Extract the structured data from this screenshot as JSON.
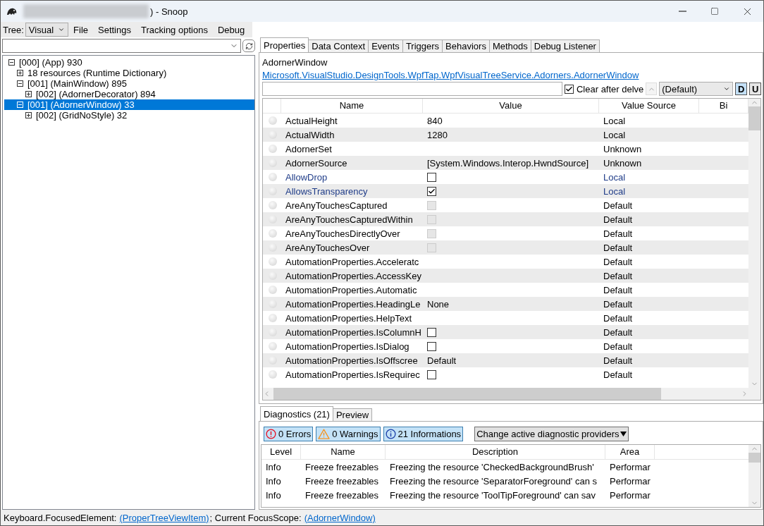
{
  "window": {
    "title": ") - Snoop"
  },
  "toolbar": {
    "tree_label": "Tree:",
    "tree_mode": "Visual",
    "menu": [
      "File",
      "Settings",
      "Tracking options",
      "Debug"
    ]
  },
  "tree": [
    {
      "label": "[000]  (App) 930",
      "expanded": true,
      "selected": false,
      "children": [
        {
          "label": "18 resources (Runtime Dictionary)",
          "expanded": false,
          "selected": false
        },
        {
          "label": "[001]  (MainWindow) 895",
          "expanded": true,
          "selected": false,
          "children": [
            {
              "label": "[002]  (AdornerDecorator) 894",
              "expanded": false,
              "selected": false
            }
          ]
        },
        {
          "label": "[001]  (AdornerWindow) 33",
          "expanded": true,
          "selected": true,
          "children": [
            {
              "label": "[002]  (GridNoStyle) 32",
              "expanded": false,
              "selected": false
            }
          ]
        }
      ]
    }
  ],
  "property_tabs": [
    {
      "label": "Properties",
      "selected": true
    },
    {
      "label": "Data Context",
      "selected": false
    },
    {
      "label": "Events",
      "selected": false
    },
    {
      "label": "Triggers",
      "selected": false
    },
    {
      "label": "Behaviors",
      "selected": false
    },
    {
      "label": "Methods",
      "selected": false
    },
    {
      "label": "Debug Listener",
      "selected": false
    }
  ],
  "inspected": {
    "name": "AdornerWindow",
    "type_link": "Microsoft.VisualStudio.DesignTools.WpfTap.WpfVisualTreeService.Adorners.AdornerWindow"
  },
  "filter": {
    "clear_after_delve": {
      "label": "Clear after delve",
      "checked": true
    },
    "style_option": "(Default)",
    "buttons": [
      {
        "label": "D",
        "selected": true
      },
      {
        "label": "U",
        "selected": false
      }
    ]
  },
  "properties": {
    "columns": [
      "Name",
      "Value",
      "Value Source",
      "Bi"
    ],
    "rows": [
      {
        "name": "ActualHeight",
        "kind": "text",
        "value": "840",
        "source": "Local",
        "local": false
      },
      {
        "name": "ActualWidth",
        "kind": "text",
        "value": "1280",
        "source": "Local",
        "local": false
      },
      {
        "name": "AdornerSet",
        "kind": "text",
        "source": "Unknown",
        "local": false
      },
      {
        "name": "AdornerSource",
        "kind": "text",
        "value": "[System.Windows.Interop.HwndSource]",
        "source": "Unknown",
        "local": false
      },
      {
        "name": "AllowDrop",
        "kind": "checkbox",
        "checked": false,
        "disabled": false,
        "source": "Local",
        "local": true
      },
      {
        "name": "AllowsTransparency",
        "kind": "checkbox",
        "checked": true,
        "disabled": false,
        "source": "Local",
        "local": true
      },
      {
        "name": "AreAnyTouchesCaptured",
        "kind": "checkbox",
        "checked": false,
        "disabled": true,
        "source": "Default",
        "local": false
      },
      {
        "name": "AreAnyTouchesCapturedWithin",
        "kind": "checkbox",
        "checked": false,
        "disabled": true,
        "source": "Default",
        "local": false
      },
      {
        "name": "AreAnyTouchesDirectlyOver",
        "kind": "checkbox",
        "checked": false,
        "disabled": true,
        "source": "Default",
        "local": false
      },
      {
        "name": "AreAnyTouchesOver",
        "kind": "checkbox",
        "checked": false,
        "disabled": true,
        "source": "Default",
        "local": false
      },
      {
        "name": "AutomationProperties.Acceleratc",
        "kind": "text",
        "source": "Default",
        "local": false
      },
      {
        "name": "AutomationProperties.AccessKey",
        "kind": "text",
        "source": "Default",
        "local": false
      },
      {
        "name": "AutomationProperties.Automatic",
        "kind": "text",
        "source": "Default",
        "local": false
      },
      {
        "name": "AutomationProperties.HeadingLe",
        "kind": "text",
        "value": "None",
        "source": "Default",
        "local": false
      },
      {
        "name": "AutomationProperties.HelpText",
        "kind": "text",
        "source": "Default",
        "local": false
      },
      {
        "name": "AutomationProperties.IsColumnH",
        "kind": "checkbox",
        "checked": false,
        "disabled": false,
        "source": "Default",
        "local": false
      },
      {
        "name": "AutomationProperties.IsDialog",
        "kind": "checkbox",
        "checked": false,
        "disabled": false,
        "source": "Default",
        "local": false
      },
      {
        "name": "AutomationProperties.IsOffscree",
        "kind": "text",
        "value": "Default",
        "source": "Default",
        "local": false
      },
      {
        "name": "AutomationProperties.IsRequirec",
        "kind": "checkbox",
        "checked": false,
        "disabled": false,
        "source": "Default",
        "local": false
      }
    ]
  },
  "bottom_tabs": [
    {
      "label": "Diagnostics (21)",
      "selected": true
    },
    {
      "label": "Preview",
      "selected": false
    }
  ],
  "diagnostic_filters": [
    {
      "kind": "error",
      "label": "0 Errors",
      "on": true
    },
    {
      "kind": "warning",
      "label": "0 Warnings",
      "on": true
    },
    {
      "kind": "info",
      "label": "21 Informations",
      "on": true
    }
  ],
  "providers_button": "Change active diagnostic providers",
  "diagnostics": {
    "columns": [
      "Level",
      "Name",
      "Description",
      "Area"
    ],
    "rows": [
      {
        "level": "Info",
        "name": "Freeze freezables",
        "description": "Freezing the resource 'CheckedBackgroundBrush'",
        "area": "Performar"
      },
      {
        "level": "Info",
        "name": "Freeze freezables",
        "description": "Freezing the resource 'SeparatorForeground' can s",
        "area": "Performar"
      },
      {
        "level": "Info",
        "name": "Freeze freezables",
        "description": "Freezing the resource 'ToolTipForeground' can sav",
        "area": "Performar"
      }
    ]
  },
  "status_bar": {
    "focused_label": "Keyboard.FocusedElement:",
    "focused_link": "(ProperTreeViewItem)",
    "scope_label": "; Current FocusScope:",
    "scope_link": "(AdornerWindow)"
  }
}
